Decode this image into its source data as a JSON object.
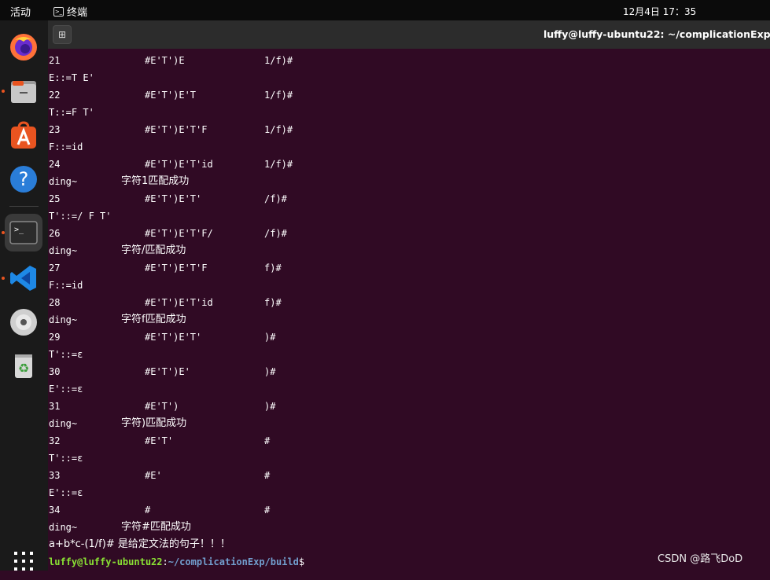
{
  "topbar": {
    "activities": "活动",
    "app_name": "终端",
    "clock": "12月4日  17：35"
  },
  "window": {
    "title": "luffy@luffy-ubuntu22: ~/complicationExp/build"
  },
  "dock": [
    {
      "name": "firefox-icon",
      "running": false
    },
    {
      "name": "files-icon",
      "running": true
    },
    {
      "name": "app-store-icon",
      "running": false
    },
    {
      "name": "help-icon",
      "running": false
    },
    {
      "name": "terminal-icon",
      "running": true
    },
    {
      "name": "vscode-icon",
      "running": true
    },
    {
      "name": "disc-icon",
      "running": false
    },
    {
      "name": "trash-icon",
      "running": false
    },
    {
      "name": "show-apps-icon",
      "running": false
    }
  ],
  "terminal": {
    "lines": [
      {
        "cols": [
          "21",
          "#E'T')E",
          "1/f)#"
        ]
      },
      {
        "cols": [
          "E::=T E'"
        ]
      },
      {
        "cols": [
          "22",
          "#E'T')E'T",
          "1/f)#"
        ]
      },
      {
        "cols": [
          "T::=F T'"
        ]
      },
      {
        "cols": [
          "23",
          "#E'T')E'T'F",
          "1/f)#"
        ]
      },
      {
        "cols": [
          "F::=id"
        ]
      },
      {
        "cols": [
          "24",
          "#E'T')E'T'id",
          "1/f)#"
        ]
      },
      {
        "cols": [
          "ding~",
          "字符1匹配成功"
        ]
      },
      {
        "cols": [
          "25",
          "#E'T')E'T'",
          "/f)#"
        ]
      },
      {
        "cols": [
          "T'::=/ F T'"
        ]
      },
      {
        "cols": [
          "26",
          "#E'T')E'T'F/",
          "/f)#"
        ]
      },
      {
        "cols": [
          "ding~",
          "字符/匹配成功"
        ]
      },
      {
        "cols": [
          "27",
          "#E'T')E'T'F",
          "f)#"
        ]
      },
      {
        "cols": [
          "F::=id"
        ]
      },
      {
        "cols": [
          "28",
          "#E'T')E'T'id",
          "f)#"
        ]
      },
      {
        "cols": [
          "ding~",
          "字符f匹配成功"
        ]
      },
      {
        "cols": [
          "29",
          "#E'T')E'T'",
          ")#"
        ]
      },
      {
        "cols": [
          "T'::=ε"
        ]
      },
      {
        "cols": [
          "30",
          "#E'T')E'",
          ")#"
        ]
      },
      {
        "cols": [
          "E'::=ε"
        ]
      },
      {
        "cols": [
          "31",
          "#E'T')",
          ")#"
        ]
      },
      {
        "cols": [
          "ding~",
          "字符)匹配成功"
        ]
      },
      {
        "cols": [
          "32",
          "#E'T'",
          "#"
        ]
      },
      {
        "cols": [
          "T'::=ε"
        ]
      },
      {
        "cols": [
          "33",
          "#E'",
          "#"
        ]
      },
      {
        "cols": [
          "E'::=ε"
        ]
      },
      {
        "cols": [
          "34",
          "#",
          "#"
        ]
      },
      {
        "cols": [
          "ding~",
          "字符#匹配成功"
        ]
      },
      {
        "cols": [
          "a+b*c-(1/f)# 是给定文法的句子！！！"
        ]
      }
    ],
    "prompt": {
      "user": "luffy@luffy-ubuntu22",
      "sep": ":",
      "path": "~/complicationExp/build",
      "symbol": "$"
    }
  },
  "watermark": "CSDN @路飞DoD",
  "colors": {
    "terminal_bg": "#300a24",
    "prompt_user": "#8ae234",
    "prompt_path": "#729fcf",
    "running_dot": "#e95420"
  }
}
